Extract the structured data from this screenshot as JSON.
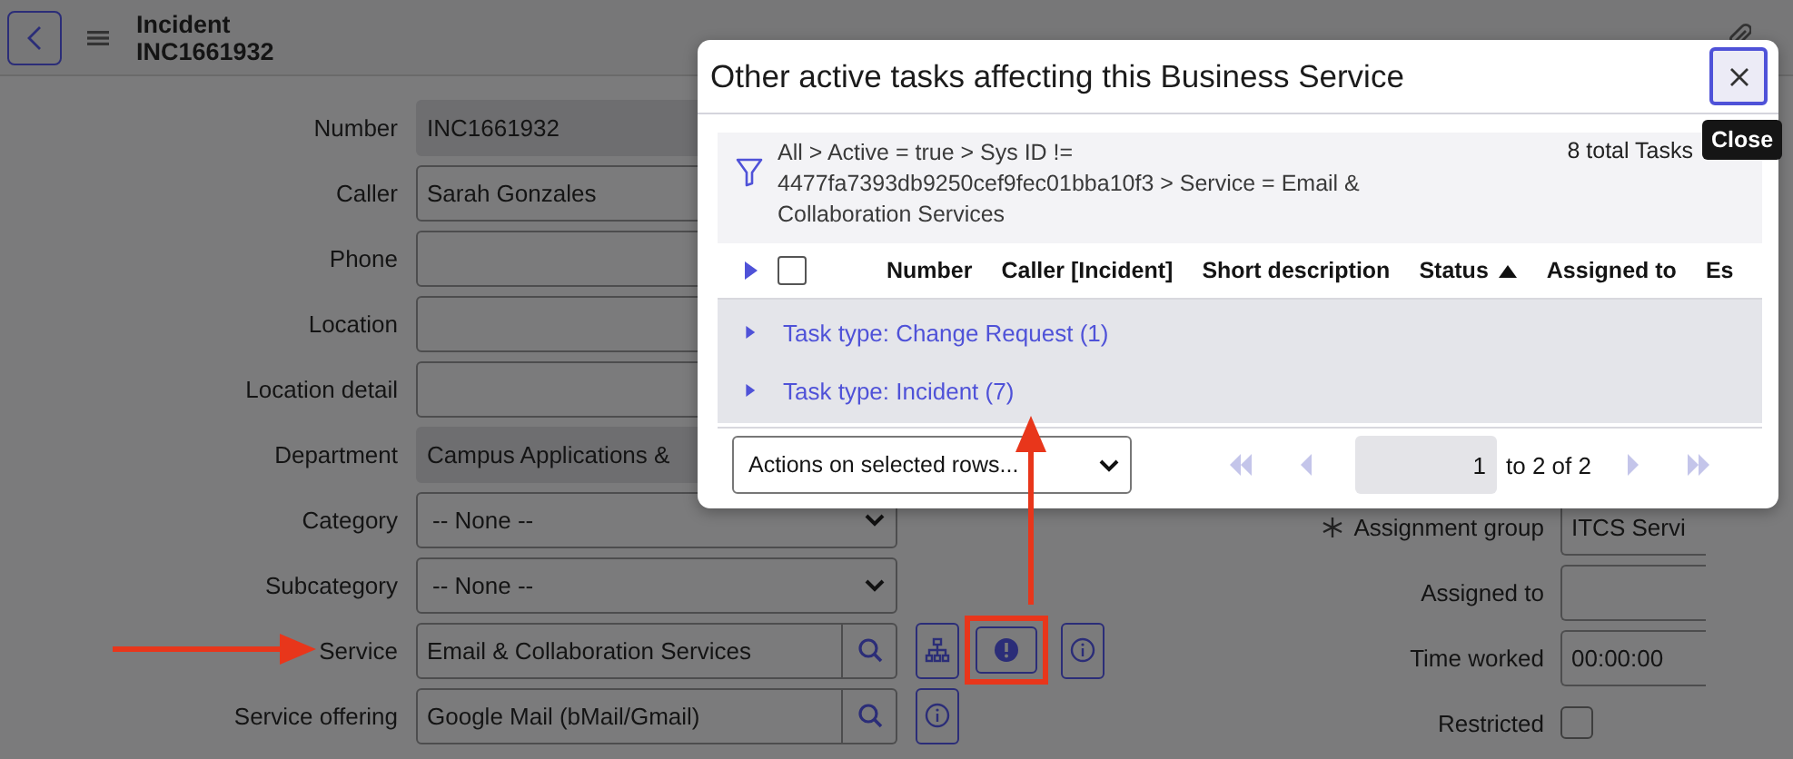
{
  "header": {
    "title": "Incident",
    "subtitle": "INC1661932"
  },
  "form_left": [
    {
      "label": "Number",
      "value": "INC1661932",
      "kind": "readonly"
    },
    {
      "label": "Caller",
      "value": "Sarah Gonzales",
      "kind": "text"
    },
    {
      "label": "Phone",
      "kind": "text"
    },
    {
      "label": "Location",
      "kind": "text"
    },
    {
      "label": "Location detail",
      "kind": "text"
    },
    {
      "label": "Department",
      "value": "Campus Applications &",
      "kind": "readonly"
    },
    {
      "label": "Category",
      "value": "-- None --",
      "kind": "select"
    },
    {
      "label": "Subcategory",
      "value": "-- None --",
      "kind": "select"
    },
    {
      "label": "Service",
      "value": "Email & Collaboration Services",
      "kind": "reference",
      "actions": [
        {
          "kind": "tree",
          "highlighted": false
        },
        {
          "kind": "alert",
          "highlighted": true
        },
        {
          "kind": "info",
          "highlighted": false
        }
      ]
    },
    {
      "label": "Service offering",
      "value": "Google Mail (bMail/Gmail)",
      "kind": "reference",
      "actions": [
        {
          "kind": "info",
          "highlighted": false
        }
      ]
    }
  ],
  "form_right": [
    {
      "label": "Assignment group",
      "value": "ITCS Servi",
      "kind": "text",
      "mandatory": true
    },
    {
      "label": "Assigned to",
      "kind": "text",
      "mandatory": false
    },
    {
      "label": "Time worked",
      "value": "00:00:00",
      "kind": "text",
      "mandatory": false
    },
    {
      "label": "Restricted",
      "kind": "checkbox",
      "checked": false,
      "mandatory": false
    }
  ],
  "modal": {
    "title": "Other active tasks affecting this Business Service",
    "close_tooltip": "Close",
    "filter": {
      "breadcrumb": "All > Active = true > Sys ID != 4477fa7393db9250cef9fec01bba10f3 > Service = Email & Collaboration Services",
      "total": "8 total Tasks"
    },
    "select_all_checked": false,
    "columns": [
      {
        "label": "Number",
        "sorted": false
      },
      {
        "label": "Caller [Incident]",
        "sorted": false
      },
      {
        "label": "Short description",
        "sorted": false
      },
      {
        "label": "Status",
        "sorted": true
      },
      {
        "label": "Assigned to",
        "sorted": false
      },
      {
        "label": "Es",
        "sorted": false
      }
    ],
    "groups": [
      {
        "label": "Task type: Change Request (1)",
        "expanded": false
      },
      {
        "label": "Task type: Incident (7)",
        "expanded": false
      }
    ],
    "actions_select": "Actions on selected rows...",
    "pagination": {
      "page": "1",
      "range": "to 2 of 2"
    }
  }
}
